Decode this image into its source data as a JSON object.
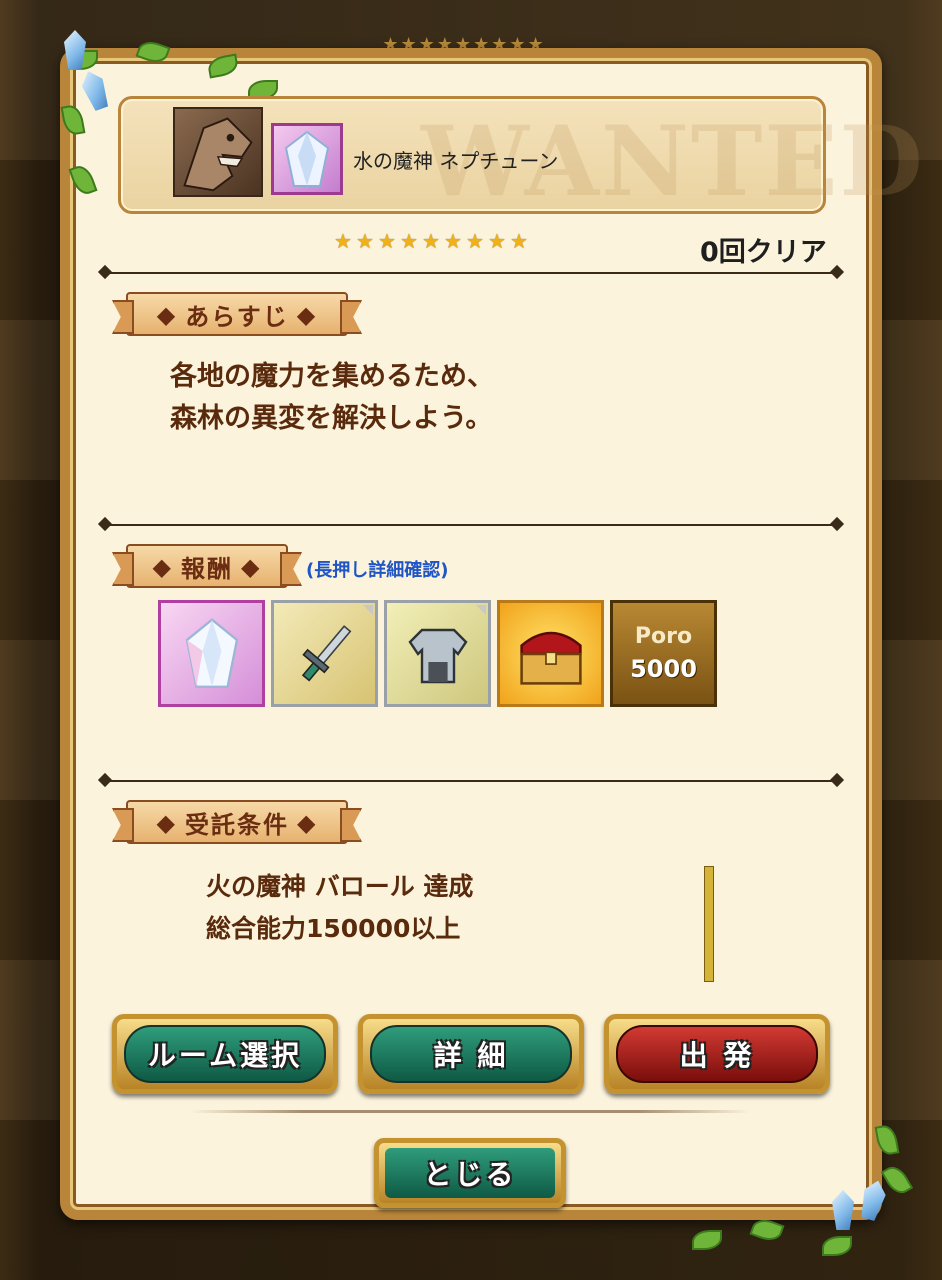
{
  "quest": {
    "boss_name": "水の魔神 ネプチューン",
    "watermark": "WANTED",
    "difficulty_stars": 9,
    "clear_count": "0回クリア"
  },
  "sections": {
    "story_title": "あらすじ",
    "story_lines": [
      "各地の魔力を集めるため、",
      "森林の異変を解決しよう。"
    ],
    "reward_title": "報酬",
    "reward_hint": "(長押し詳細確認)",
    "condition_title": "受託条件",
    "condition_lines": [
      "火の魔神 バロール 達成",
      "総合能力150000以上"
    ]
  },
  "rewards": [
    {
      "icon": "crystal-gem-icon"
    },
    {
      "icon": "sword-icon"
    },
    {
      "icon": "armor-icon"
    },
    {
      "icon": "treasure-chest-icon"
    },
    {
      "icon": "poro-currency-icon",
      "label": "Poro",
      "amount": "5000"
    }
  ],
  "buttons": {
    "room_select": "ルーム選択",
    "details": "詳 細",
    "depart": "出 発",
    "close": "とじる"
  },
  "colors": {
    "panel": "#fbf3dc",
    "gold_frame": "#b8853a",
    "green_button": "#1f7a5e",
    "red_button": "#b01e18",
    "hint_blue": "#1f55c4",
    "text_brown": "#5a2a0c"
  }
}
